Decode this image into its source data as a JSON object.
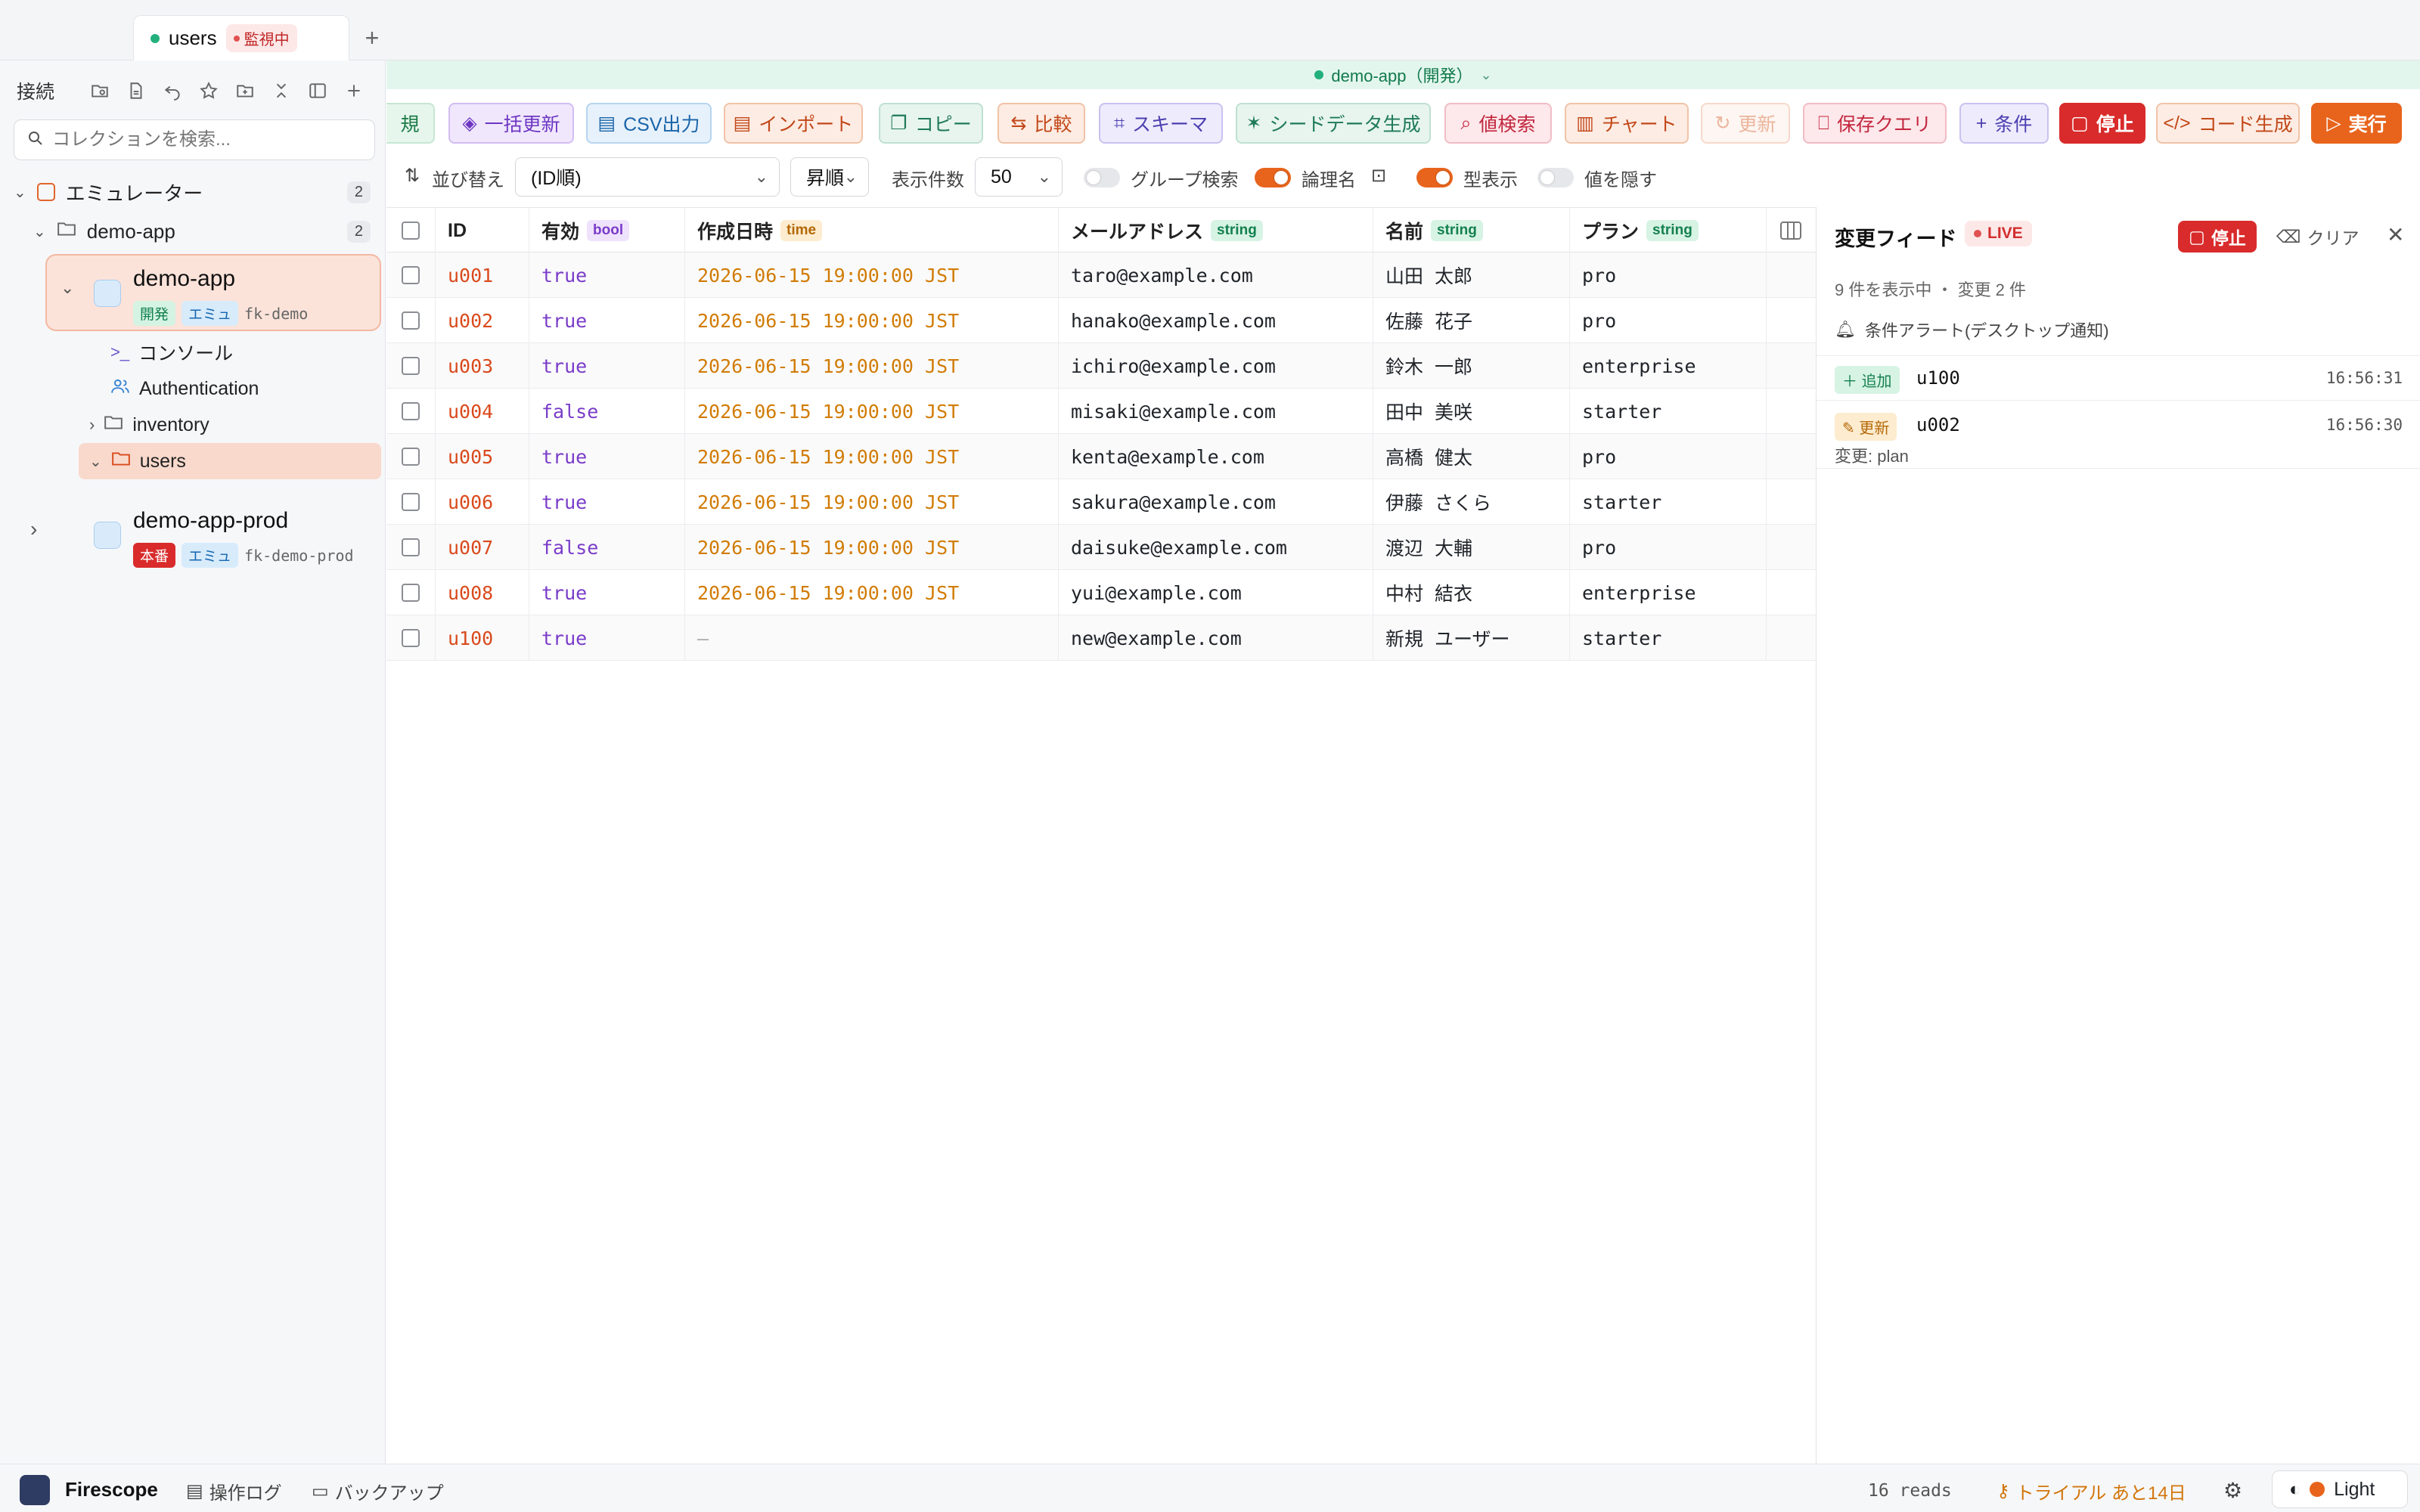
{
  "tab": {
    "name": "users",
    "watch_label": "監視中",
    "add": "+"
  },
  "sidebar": {
    "title": "接続",
    "search_placeholder": "コレクションを検索...",
    "group": {
      "label": "エミュレーター",
      "count": "2"
    },
    "project": {
      "label": "demo-app",
      "count": "2"
    },
    "connections": [
      {
        "name": "demo-app",
        "env": "開発",
        "type": "エミュ",
        "project_id": "fk-demo",
        "children": [
          {
            "label": "コンソール"
          },
          {
            "label": "Authentication"
          },
          {
            "label": "inventory"
          },
          {
            "label": "users"
          }
        ]
      },
      {
        "name": "demo-app-prod",
        "env": "本番",
        "type": "エミュ",
        "project_id": "fk-demo-prod"
      }
    ]
  },
  "envbar": {
    "label": "demo-app（開発）"
  },
  "toolbar": {
    "buttons": [
      {
        "label": "規"
      },
      {
        "label": "一括更新"
      },
      {
        "label": "CSV出力"
      },
      {
        "label": "インポート"
      },
      {
        "label": "コピー"
      },
      {
        "label": "比較"
      },
      {
        "label": "スキーマ"
      },
      {
        "label": "シードデータ生成"
      },
      {
        "label": "値検索"
      },
      {
        "label": "チャート"
      },
      {
        "label": "更新"
      },
      {
        "label": "保存クエリ"
      },
      {
        "label": "条件"
      },
      {
        "label": "停止"
      },
      {
        "label": "コード生成"
      },
      {
        "label": "実行"
      }
    ]
  },
  "options": {
    "sort_label": "並び替え",
    "sort_value": "(ID順)",
    "order_value": "昇順",
    "limit_label": "表示件数",
    "limit_value": "50",
    "group_search_label": "グループ検索",
    "logical_name_label": "論理名",
    "type_display_label": "型表示",
    "hide_values_label": "値を隠す",
    "group_search_on": false,
    "logical_name_on": true,
    "type_display_on": true,
    "hide_values_on": false
  },
  "table": {
    "columns": [
      {
        "label": "ID",
        "type": ""
      },
      {
        "label": "有効",
        "type": "bool"
      },
      {
        "label": "作成日時",
        "type": "time"
      },
      {
        "label": "メールアドレス",
        "type": "string"
      },
      {
        "label": "名前",
        "type": "string"
      },
      {
        "label": "プラン",
        "type": "string"
      }
    ],
    "rows": [
      [
        "u001",
        "true",
        "2026-06-15 19:00:00 JST",
        "taro@example.com",
        "山田 太郎",
        "pro"
      ],
      [
        "u002",
        "true",
        "2026-06-15 19:00:00 JST",
        "hanako@example.com",
        "佐藤 花子",
        "pro"
      ],
      [
        "u003",
        "true",
        "2026-06-15 19:00:00 JST",
        "ichiro@example.com",
        "鈴木 一郎",
        "enterprise"
      ],
      [
        "u004",
        "false",
        "2026-06-15 19:00:00 JST",
        "misaki@example.com",
        "田中 美咲",
        "starter"
      ],
      [
        "u005",
        "true",
        "2026-06-15 19:00:00 JST",
        "kenta@example.com",
        "高橋 健太",
        "pro"
      ],
      [
        "u006",
        "true",
        "2026-06-15 19:00:00 JST",
        "sakura@example.com",
        "伊藤 さくら",
        "starter"
      ],
      [
        "u007",
        "false",
        "2026-06-15 19:00:00 JST",
        "daisuke@example.com",
        "渡辺 大輔",
        "pro"
      ],
      [
        "u008",
        "true",
        "2026-06-15 19:00:00 JST",
        "yui@example.com",
        "中村 結衣",
        "enterprise"
      ],
      [
        "u100",
        "true",
        "—",
        "new@example.com",
        "新規 ユーザー",
        "starter"
      ]
    ]
  },
  "feed": {
    "title": "変更フィード",
    "live_label": "LIVE",
    "stop_label": "停止",
    "clear_label": "クリア",
    "summary": "9 件を表示中 ・ 変更 2 件",
    "alert_label": "条件アラート(デスクトップ通知)",
    "events": [
      {
        "kind": "追加",
        "id": "u100",
        "time": "16:56:31",
        "note": ""
      },
      {
        "kind": "更新",
        "id": "u002",
        "time": "16:56:30",
        "note": "変更: plan"
      }
    ]
  },
  "status": {
    "app_name": "Firescope",
    "ops_log": "操作ログ",
    "backup": "バックアップ",
    "reads": "16 reads",
    "trial": "トライアル あと14日",
    "theme": "Light"
  }
}
